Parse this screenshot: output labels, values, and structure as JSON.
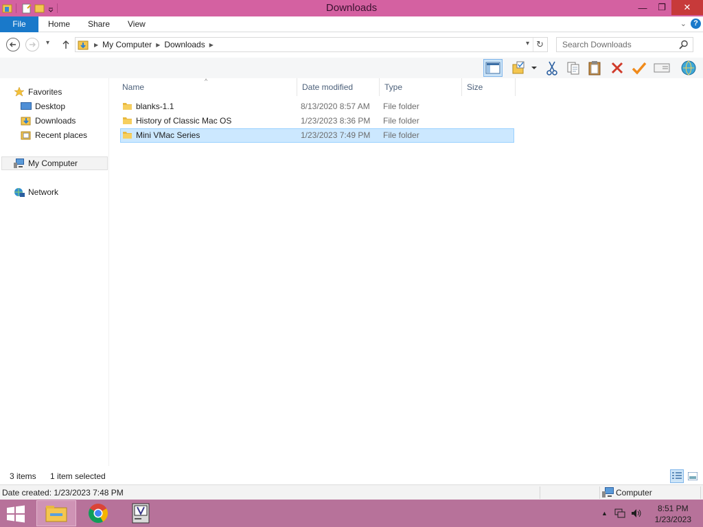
{
  "window": {
    "title": "Downloads",
    "minimize": "—",
    "maximize": "❐",
    "close": "✕"
  },
  "ribbon": {
    "file_tab": "File",
    "tabs": [
      "Home",
      "Share",
      "View"
    ],
    "expand": "⌄",
    "help": "?"
  },
  "address": {
    "crumbs": [
      "My Computer",
      "Downloads"
    ],
    "search_placeholder": "Search Downloads"
  },
  "nav_pane": {
    "favorites": "Favorites",
    "favorites_items": [
      "Desktop",
      "Downloads",
      "Recent places"
    ],
    "my_computer": "My Computer",
    "network": "Network"
  },
  "columns": {
    "name": "Name",
    "date_modified": "Date modified",
    "type": "Type",
    "size": "Size"
  },
  "files": [
    {
      "name": "blanks-1.1",
      "date": "8/13/2020 8:57 AM",
      "type": "File folder",
      "selected": false
    },
    {
      "name": "History of Classic Mac OS",
      "date": "1/23/2023 8:36 PM",
      "type": "File folder",
      "selected": false
    },
    {
      "name": "Mini VMac Series",
      "date": "1/23/2023 7:49 PM",
      "type": "File folder",
      "selected": true
    }
  ],
  "status": {
    "item_count": "3 items",
    "selection": "1 item selected"
  },
  "details": {
    "date_created": "Date created: 1/23/2023 7:48 PM",
    "location": "Computer"
  },
  "taskbar": {
    "time": "8:51 PM",
    "date": "1/23/2023"
  },
  "colors": {
    "title_bar": "#d461a1",
    "file_tab": "#1979ca",
    "selection": "#cce8ff",
    "taskbar": "#b7729a"
  }
}
